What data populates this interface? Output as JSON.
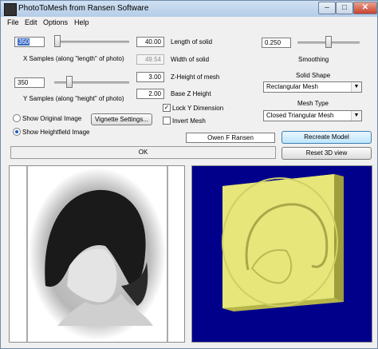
{
  "window": {
    "title": "PhotoToMesh from Ransen Software",
    "min": "–",
    "max": "□",
    "close": "✕"
  },
  "menu": [
    "File",
    "Edit",
    "Options",
    "Help"
  ],
  "x_samples": {
    "value": "350",
    "label": "X Samples (along \"length\" of photo)",
    "slider": 0.0
  },
  "y_samples": {
    "value": "350",
    "label": "Y Samples (along \"height\" of photo)",
    "slider": 0.17
  },
  "length": {
    "value": "40.00",
    "label": "Length of solid"
  },
  "width": {
    "value": "49.54",
    "label": "Width of solid"
  },
  "zheight": {
    "value": "3.00",
    "label": "Z-Height of mesh"
  },
  "basez": {
    "value": "2.00",
    "label": "Base Z Height"
  },
  "smoothing": {
    "value": "0.250",
    "label": "Smoothing",
    "slider": 0.5
  },
  "lock_y": {
    "label": "Lock Y Dimension",
    "checked": true,
    "mark": "✓"
  },
  "invert": {
    "label": "Invert Mesh",
    "checked": false
  },
  "solid_shape": {
    "label": "Solid Shape",
    "selected": "Rectangular Mesh"
  },
  "mesh_type": {
    "label": "Mesh Type",
    "selected": "Closed Triangular Mesh"
  },
  "radio": {
    "original": "Show Original Image",
    "heightfield": "Show Heightfield Image",
    "selected": "heightfield"
  },
  "buttons": {
    "vignette": "Vignette Settings...",
    "recreate": "Recreate Model",
    "reset": "Reset 3D view"
  },
  "owner": "Owen F Ransen",
  "status": "OK",
  "colors": {
    "viewport_bg": "#00008b",
    "model": "#e6e67a"
  }
}
